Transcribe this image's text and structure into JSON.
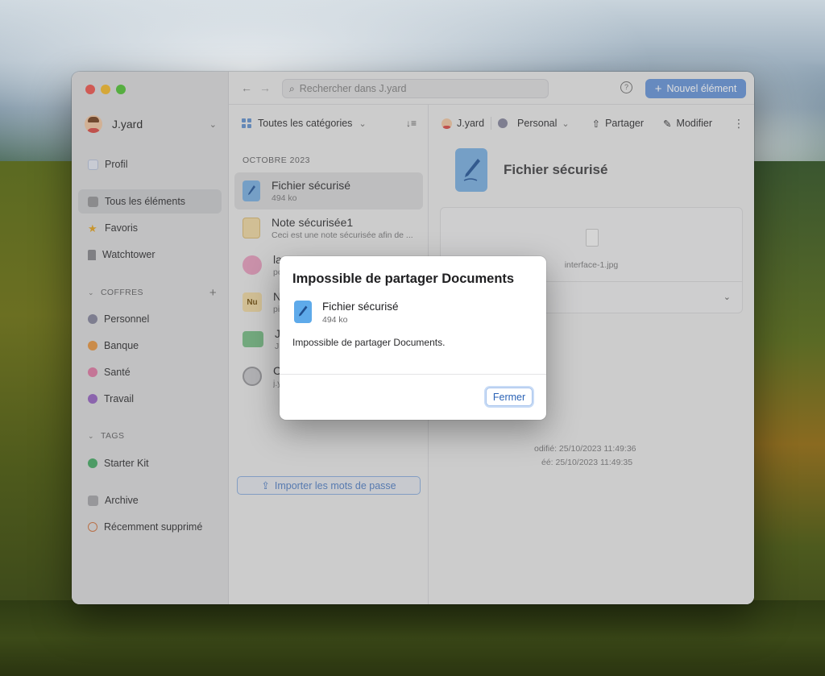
{
  "sidebar": {
    "account_name": "J.yard",
    "profile": "Profil",
    "items": [
      {
        "label": "Tous les éléments"
      },
      {
        "label": "Favoris"
      },
      {
        "label": "Watchtower"
      }
    ],
    "vaults_header": "COFFRES",
    "vaults": [
      {
        "label": "Personnel",
        "color": "#8a8aa0"
      },
      {
        "label": "Banque",
        "color": "#e79a4a"
      },
      {
        "label": "Santé",
        "color": "#e07fa8"
      },
      {
        "label": "Travail",
        "color": "#9a6bc4"
      }
    ],
    "tags_header": "TAGS",
    "tags": [
      {
        "label": "Starter Kit",
        "color": "#4fae6c"
      }
    ],
    "archive": "Archive",
    "recently_deleted": "Récemment supprimé"
  },
  "toolbar": {
    "search_placeholder": "Rechercher dans J.yard",
    "new_item": "Nouvel élément"
  },
  "list": {
    "category": "Toutes les catégories",
    "month": "OCTOBRE 2023",
    "items": [
      {
        "title": "Fichier sécurisé",
        "subtitle": "494 ko"
      },
      {
        "title": "Note sécurisée1",
        "subtitle": "Ceci est une note sécurisée afin de ..."
      },
      {
        "title": "la",
        "subtitle": "pc"
      },
      {
        "title": "N",
        "subtitle": "pi"
      },
      {
        "title": "J.",
        "subtitle": "J.y"
      },
      {
        "title": "C",
        "subtitle": "j.y"
      }
    ],
    "nu_badge": "Nu",
    "import_button": "Importer les mots de passe"
  },
  "detail": {
    "owner": "J.yard",
    "vault": "Personal",
    "share": "Partager",
    "edit": "Modifier",
    "title": "Fichier sécurisé",
    "attachment": "interface-1.jpg",
    "modified": "odifié: 25/10/2023 11:49:36",
    "created": "éé: 25/10/2023 11:49:35"
  },
  "modal": {
    "title": "Impossible de partager Documents",
    "item_title": "Fichier sécurisé",
    "item_size": "494 ko",
    "message": "Impossible de partager Documents.",
    "close_button": "Fermer"
  },
  "colors": {
    "accent": "#6d99da",
    "modal_button_text": "#2b63b6"
  }
}
